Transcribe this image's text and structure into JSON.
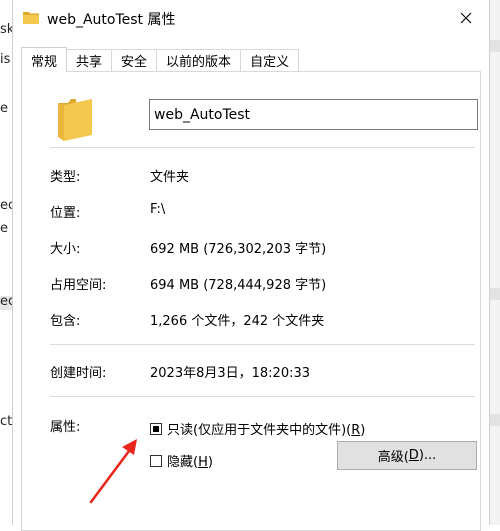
{
  "background": {
    "fragments": [
      "sk",
      "is",
      "e",
      "ec",
      "e",
      "ec",
      "ct"
    ]
  },
  "dialog": {
    "title": "web_AutoTest 属性",
    "tabs": [
      {
        "label": "常规",
        "active": true
      },
      {
        "label": "共享",
        "active": false
      },
      {
        "label": "安全",
        "active": false
      },
      {
        "label": "以前的版本",
        "active": false
      },
      {
        "label": "自定义",
        "active": false
      }
    ],
    "name_value": "web_AutoTest",
    "fields": {
      "type_label": "类型:",
      "type_value": "文件夹",
      "location_label": "位置:",
      "location_value": "F:\\",
      "size_label": "大小:",
      "size_value": "692 MB (726,302,203 字节)",
      "disk_label": "占用空间:",
      "disk_value": "694 MB (728,444,928 字节)",
      "contains_label": "包含:",
      "contains_value": "1,266 个文件，242 个文件夹",
      "created_label": "创建时间:",
      "created_value": "2023年8月3日，18:20:33",
      "attributes_label": "属性:"
    },
    "readonly": {
      "label": "只读(仅应用于文件夹中的文件)(",
      "hotkey": "R",
      "suffix": ")",
      "state": "indeterminate"
    },
    "hidden": {
      "label": "隐藏(",
      "hotkey": "H",
      "suffix": ")",
      "checked": false
    },
    "advanced_button": {
      "label": "高级(",
      "hotkey": "D",
      "suffix": ")..."
    }
  },
  "colors": {
    "folder": "#f4c84f",
    "annotation_arrow": "#e8261c"
  },
  "icons": {
    "title": "folder-icon",
    "close": "close-icon",
    "large": "folder-icon"
  }
}
